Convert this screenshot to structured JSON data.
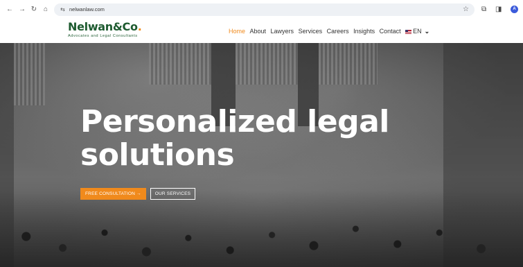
{
  "browser": {
    "url": "nelwanlaw.com",
    "back_icon": "←",
    "forward_icon": "→",
    "reload_icon": "↻",
    "home_icon": "⌂",
    "site_info_icon": "⇆",
    "bookmark_icon": "☆",
    "extensions_icon": "⧉",
    "sidepanel_icon": "◨",
    "profile_initial": "A"
  },
  "site": {
    "logo": {
      "name": "Nelwan&Co",
      "dot": ".",
      "tagline": "Advocates and Legal Consultants"
    },
    "nav": {
      "items": [
        {
          "label": "Home",
          "active": true
        },
        {
          "label": "About"
        },
        {
          "label": "Lawyers"
        },
        {
          "label": "Services"
        },
        {
          "label": "Careers"
        },
        {
          "label": "Insights"
        },
        {
          "label": "Contact"
        }
      ],
      "language": "EN"
    }
  },
  "hero": {
    "title_line1": "Personalized legal",
    "title_line2": "solutions",
    "primary_button": "FREE CONSULTATION",
    "primary_arrow": "→",
    "secondary_button": "OUR SERVICES"
  },
  "colors": {
    "brand_green": "#1e5b30",
    "accent_orange": "#f08a1c"
  }
}
